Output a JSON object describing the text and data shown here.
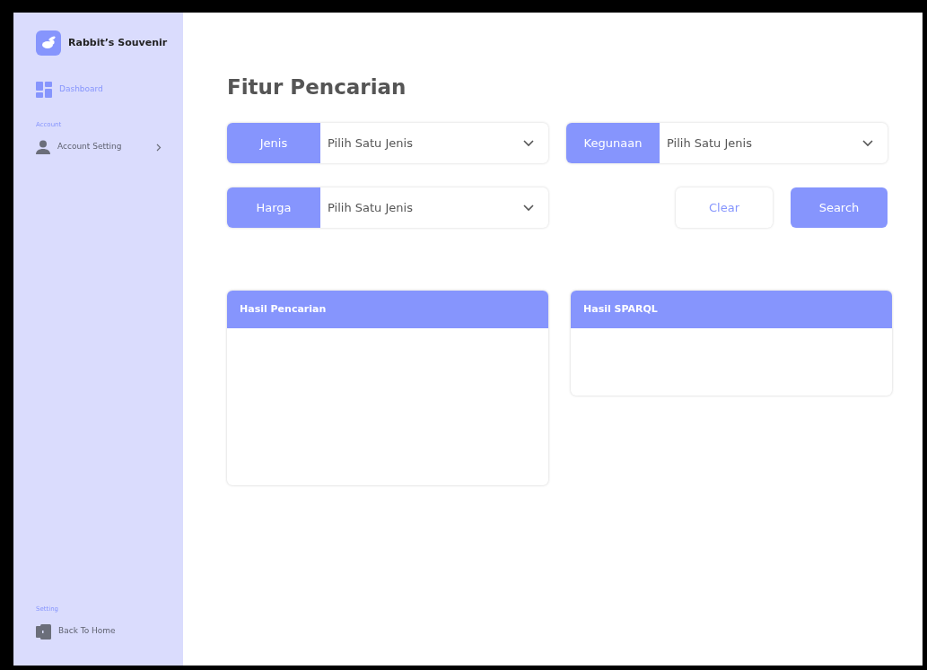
{
  "brand": {
    "name": "Rabbit’s Souvenir"
  },
  "sidebar": {
    "items": [
      {
        "label": "Dashboard",
        "selected": true,
        "kind": "dashboard"
      }
    ],
    "sections": [
      {
        "title": "Account",
        "items": [
          {
            "label": "Account Setting",
            "selected": false,
            "kind": "user",
            "expandable": true
          }
        ]
      }
    ],
    "footer": {
      "title": "Setting",
      "items": [
        {
          "label": "Back To Home",
          "selected": false,
          "kind": "door"
        }
      ]
    }
  },
  "page_title": "Fitur Pencarian",
  "filters": [
    {
      "label": "Jenis",
      "value": "Pilih Satu Jenis"
    },
    {
      "label": "Kegunaan",
      "value": "Pilih Satu Jenis"
    },
    {
      "label": "Harga",
      "value": "Pilih Satu Jenis"
    }
  ],
  "buttons": [
    {
      "label": "Clear",
      "kind": "secondary"
    },
    {
      "label": "Search",
      "kind": "primary"
    }
  ],
  "panels": [
    {
      "title": "Hasil Pencarian"
    },
    {
      "title": "Hasil SPARQL"
    }
  ]
}
